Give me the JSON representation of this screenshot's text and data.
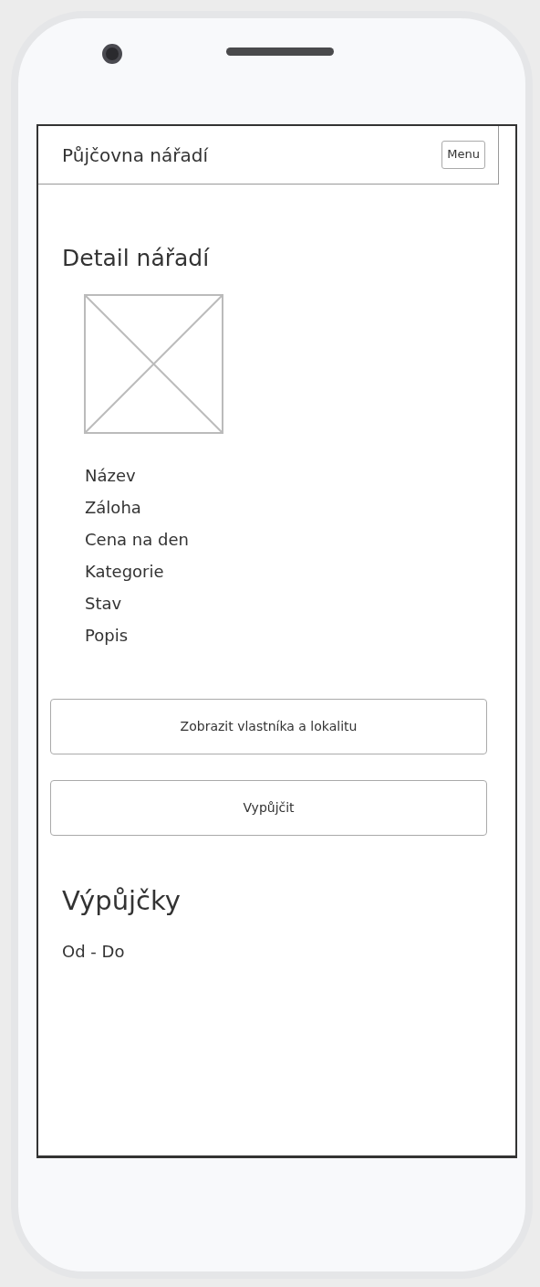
{
  "app_bar": {
    "title": "Půjčovna nářadí",
    "menu_button": "Menu"
  },
  "heading": "Detail nářadí",
  "fields": [
    "Název",
    "Záloha",
    "Cena na den",
    "Kategorie",
    "Stav",
    "Popis"
  ],
  "buttons": [
    "Zobrazit vlastníka a lokalitu",
    "Vypůjčit"
  ],
  "loans": {
    "heading": "Výpůjčky",
    "range": "Od - Do"
  }
}
